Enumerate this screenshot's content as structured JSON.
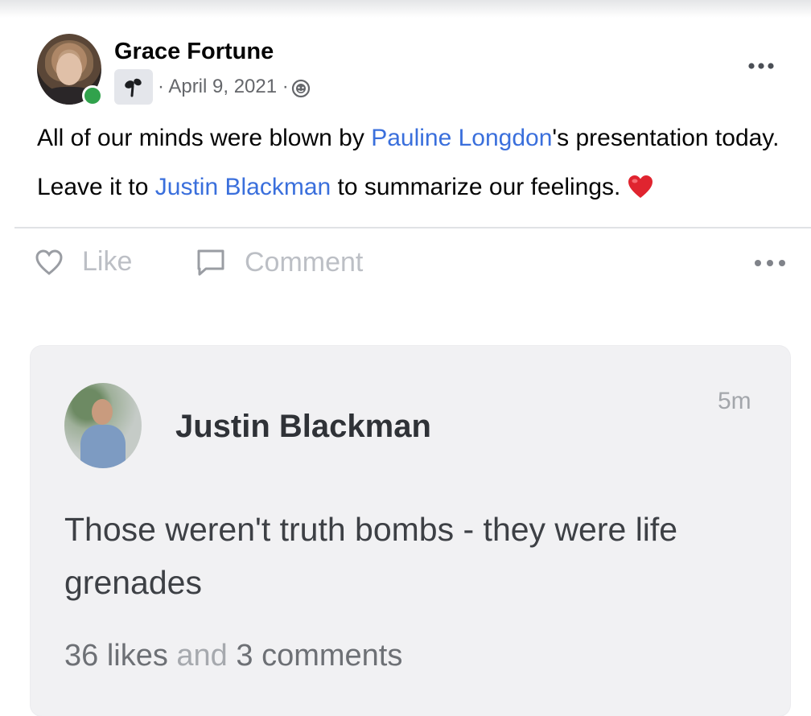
{
  "post": {
    "author": "Grace Fortune",
    "date": "· April 9, 2021 ·",
    "group_icon": "group-badge-icon",
    "privacy_icon": "globe-icon",
    "line1": {
      "before": "All of our minds were blown by ",
      "mention": "Pauline Longdon",
      "after": "'s presentation today."
    },
    "line2": {
      "before": "Leave it to ",
      "mention": "Justin Blackman",
      "after": " to summarize our feelings."
    },
    "mention_color": "#3a6fdc"
  },
  "actions": {
    "like_label": "Like",
    "comment_label": "Comment"
  },
  "comment": {
    "author": "Justin Blackman",
    "time": "5m",
    "text": "Those weren't truth bombs - they were life grenades",
    "likes": "36 likes",
    "and": "and",
    "comments": "3 comments"
  }
}
